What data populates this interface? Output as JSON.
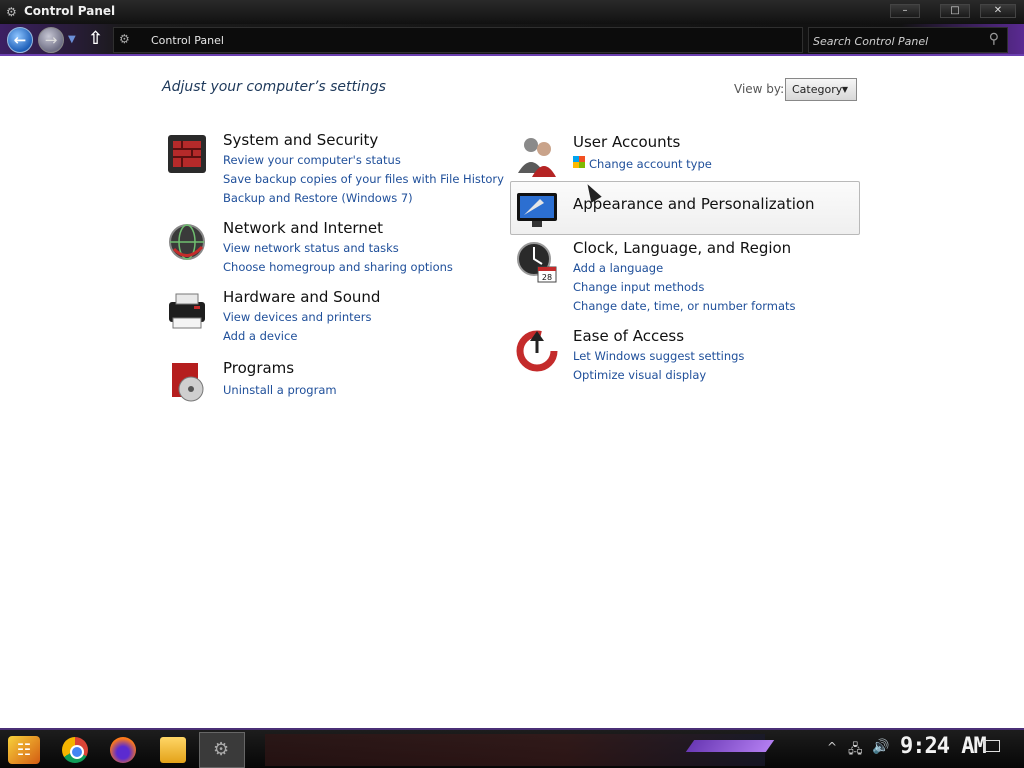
{
  "window": {
    "title": "Control Panel",
    "minimize": "–",
    "maximize": "□",
    "close": "✕"
  },
  "navbar": {
    "back": "←",
    "forward": "→",
    "up": "⇧",
    "breadcrumb": "Control Panel",
    "search_placeholder": "Search Control Panel"
  },
  "main": {
    "heading": "Adjust your computer’s settings",
    "view_by_label": "View by:",
    "view_by_value": "Category"
  },
  "categories_left": [
    {
      "title": "System and Security",
      "links": [
        "Review your computer's status",
        "Save backup copies of your files with File History",
        "Backup and Restore (Windows 7)"
      ]
    },
    {
      "title": "Network and Internet",
      "links": [
        "View network status and tasks",
        "Choose homegroup and sharing options"
      ]
    },
    {
      "title": "Hardware and Sound",
      "links": [
        "View devices and printers",
        "Add a device"
      ]
    },
    {
      "title": "Programs",
      "links": [
        "Uninstall a program"
      ]
    }
  ],
  "categories_right": [
    {
      "title": "User Accounts",
      "links": [
        "Change account type"
      ]
    },
    {
      "title": "Appearance and Personalization",
      "links": []
    },
    {
      "title": "Clock, Language, and Region",
      "links": [
        "Add a language",
        "Change input methods",
        "Change date, time, or number formats"
      ]
    },
    {
      "title": "Ease of Access",
      "links": [
        "Let Windows suggest settings",
        "Optimize visual display"
      ]
    }
  ],
  "taskbar": {
    "clock": "9:24 AM"
  },
  "colors": {
    "heading": "#1e395b",
    "link": "#1f4f9a",
    "accent": "#6b3fb0"
  }
}
